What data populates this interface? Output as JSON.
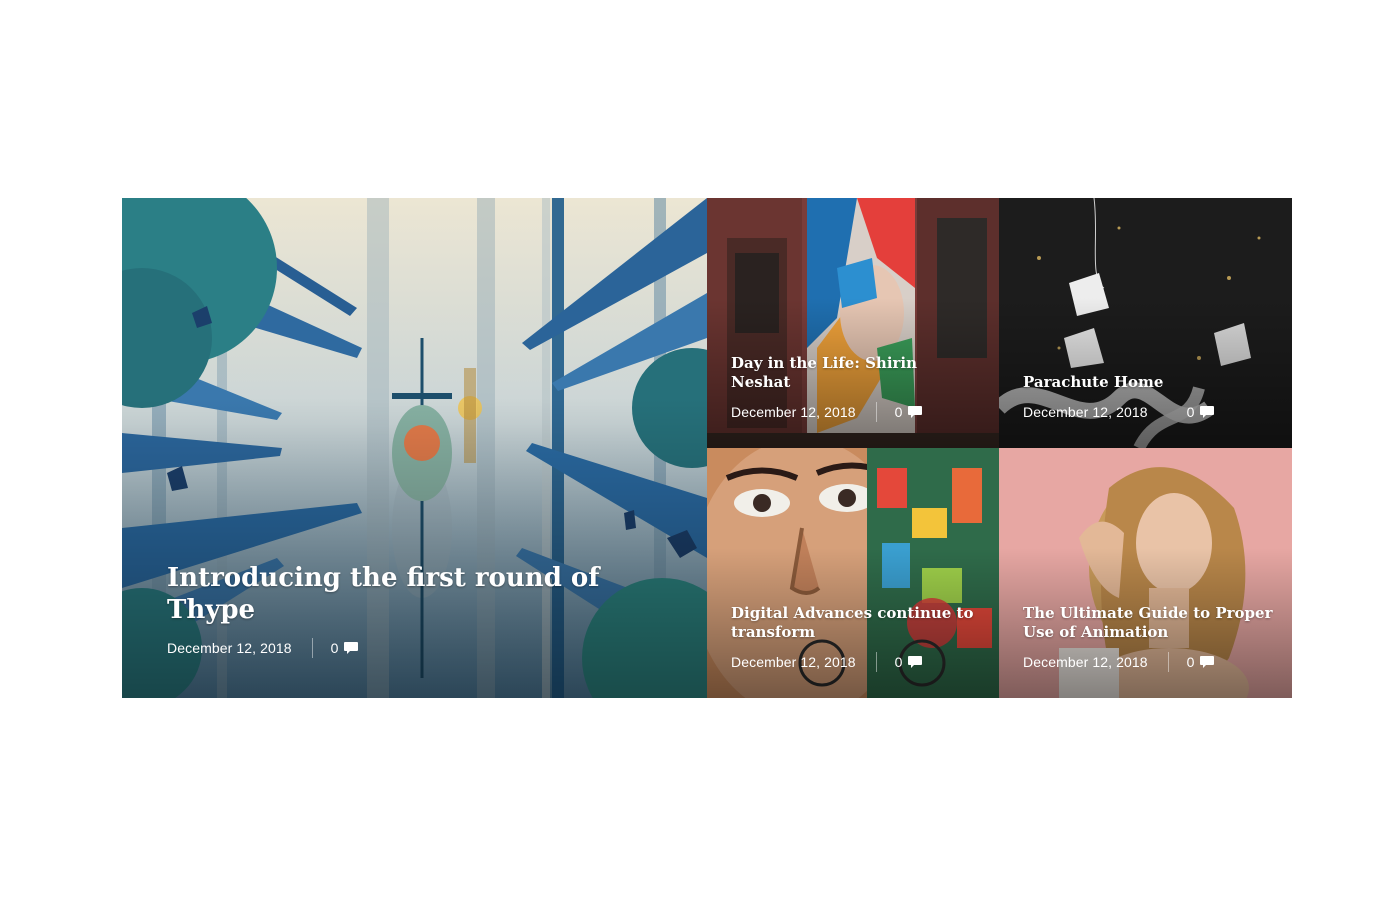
{
  "posts": [
    {
      "title": "Introducing the first round of Thype",
      "date": "December 12, 2018",
      "comments": "0",
      "comment_icon": "comment-bubble-icon"
    },
    {
      "title": "Day in the Life: Shirin Neshat",
      "date": "December 12, 2018",
      "comments": "0",
      "comment_icon": "comment-bubble-icon"
    },
    {
      "title": "Parachute Home",
      "date": "December 12, 2018",
      "comments": "0",
      "comment_icon": "comment-bubble-icon"
    },
    {
      "title": "Digital Advances continue to transform",
      "date": "December 12, 2018",
      "comments": "0",
      "comment_icon": "comment-bubble-icon"
    },
    {
      "title": "The Ultimate Guide to Proper Use of Animation",
      "date": "December 12, 2018",
      "comments": "0",
      "comment_icon": "comment-bubble-icon"
    }
  ]
}
